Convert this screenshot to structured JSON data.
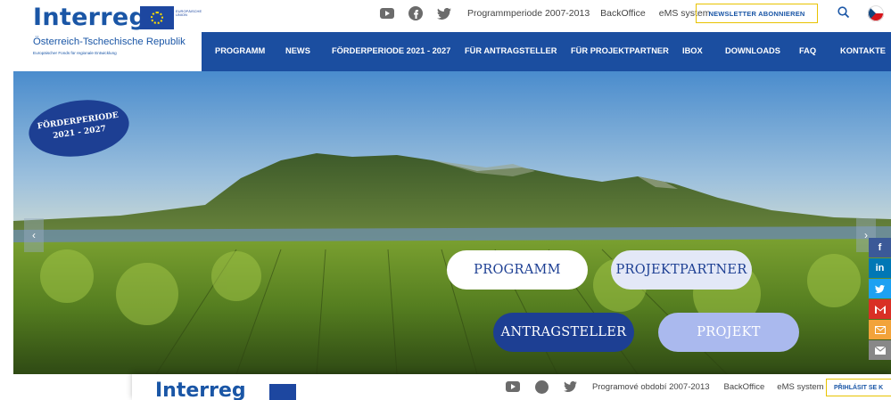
{
  "header": {
    "logo_word": "Interreg",
    "eu_flag_text": "EUROPÄISCHE UNION",
    "logo_subtitle": "Österreich-Tschechische Republik",
    "logo_subtitle_small": "Europäischer Fonds für regionale Entwicklung",
    "social_icons": [
      "youtube-icon",
      "facebook-icon",
      "twitter-icon"
    ],
    "links": [
      "Programmperiode 2007-2013",
      "BackOffice",
      "eMS system"
    ],
    "newsletter_label": "NEWSLETTER ABONNIEREN",
    "language_flag": "czech-flag-icon"
  },
  "nav": {
    "items": [
      "PROGRAMM",
      "NEWS",
      "FÖRDERPERIODE 2021 - 2027",
      "FÜR ANTRAGSTELLER",
      "FÜR PROJEKTPARTNER",
      "IBOX",
      "DOWNLOADS",
      "FAQ",
      "KONTAKTE"
    ]
  },
  "hero": {
    "badge_line1": "FÖRDERPERIODE",
    "badge_line2": "2021 - 2027",
    "buttons": [
      "PROGRAMM",
      "PROJEKTPARTNER",
      "ANTRAGSTELLER",
      "PROJEKT"
    ],
    "prev_arrow": "‹",
    "next_arrow": "›"
  },
  "share": {
    "items": [
      "f",
      "in",
      "twitter",
      "gmail",
      "email",
      "mail"
    ],
    "colors": [
      "#3b5998",
      "#0077b5",
      "#1da1f2",
      "#d93025",
      "#f2a33a",
      "#888888"
    ]
  },
  "second_header": {
    "logo_word": "Interreg",
    "links": [
      "Programové období 2007-2013",
      "BackOffice",
      "eMS system"
    ],
    "login_label": "PŘIHLÁSIT SE K"
  },
  "colors": {
    "brand_blue": "#1b4ea0",
    "dark_pill": "#1d3f93",
    "light_pill": "#aab9ee",
    "accent_yellow": "#e8c300"
  }
}
